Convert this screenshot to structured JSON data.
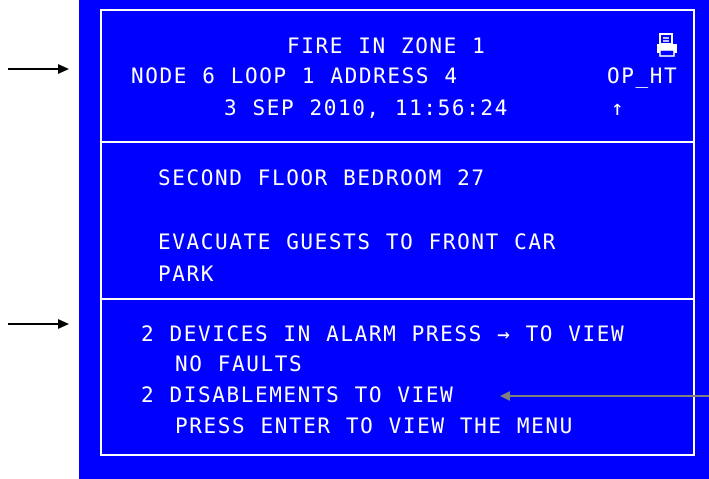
{
  "header": {
    "title": "FIRE IN ZONE 1",
    "location": "NODE 6 LOOP 1 ADDRESS 4",
    "timestamp": "3 SEP 2010, 11:56:24",
    "operator": "OP_HT",
    "up_arrow": "↑"
  },
  "message": {
    "zone_text": "SECOND FLOOR BEDROOM 27",
    "instruction_line1": "EVACUATE GUESTS TO FRONT CAR",
    "instruction_line2": "PARK"
  },
  "status": {
    "alarms": "2 DEVICES IN ALARM PRESS → TO VIEW",
    "faults": "NO FAULTS",
    "disablements": "2 DISABLEMENTS TO VIEW",
    "menu_prompt": "PRESS ENTER TO VIEW THE MENU"
  },
  "colors": {
    "screen_background": "#0000ff",
    "text": "#ffffff",
    "callout_arrow": "#808080"
  },
  "icons": [
    "printer-icon",
    "arrow-right-icon"
  ]
}
